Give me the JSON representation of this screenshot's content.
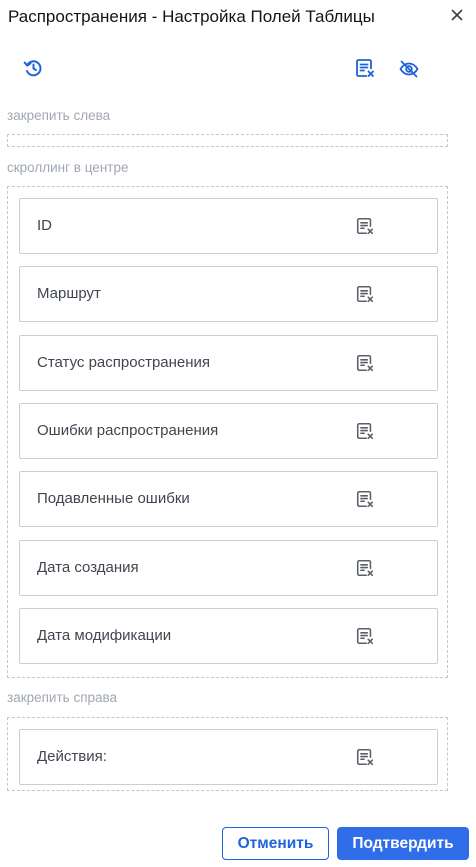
{
  "dialog": {
    "title": "Распространения - Настройка Полей Таблицы",
    "close_icon": "close-icon",
    "toolbar": {
      "reset_icon": "history-reset-icon",
      "clear_all_icon": "list-remove-icon",
      "hide_all_icon": "eye-off-icon"
    }
  },
  "sections": {
    "pinned_left": {
      "label": "закрепить слева",
      "fields": []
    },
    "scroll_center": {
      "label": "скроллинг в центре",
      "fields": [
        {
          "label": "ID"
        },
        {
          "label": "Маршрут"
        },
        {
          "label": "Статус распространения"
        },
        {
          "label": "Ошибки распространения"
        },
        {
          "label": "Подавленные ошибки"
        },
        {
          "label": "Дата создания"
        },
        {
          "label": "Дата модификации"
        }
      ]
    },
    "pinned_right": {
      "label": "закрепить справа",
      "fields": [
        {
          "label": "Действия:"
        }
      ]
    }
  },
  "footer": {
    "cancel_label": "Отменить",
    "confirm_label": "Подтвердить"
  },
  "colors": {
    "accent": "#2f6ee8",
    "accent_text": "#1f63d8",
    "muted_label": "#a1a8b2",
    "icon_gray": "#5b6068"
  }
}
